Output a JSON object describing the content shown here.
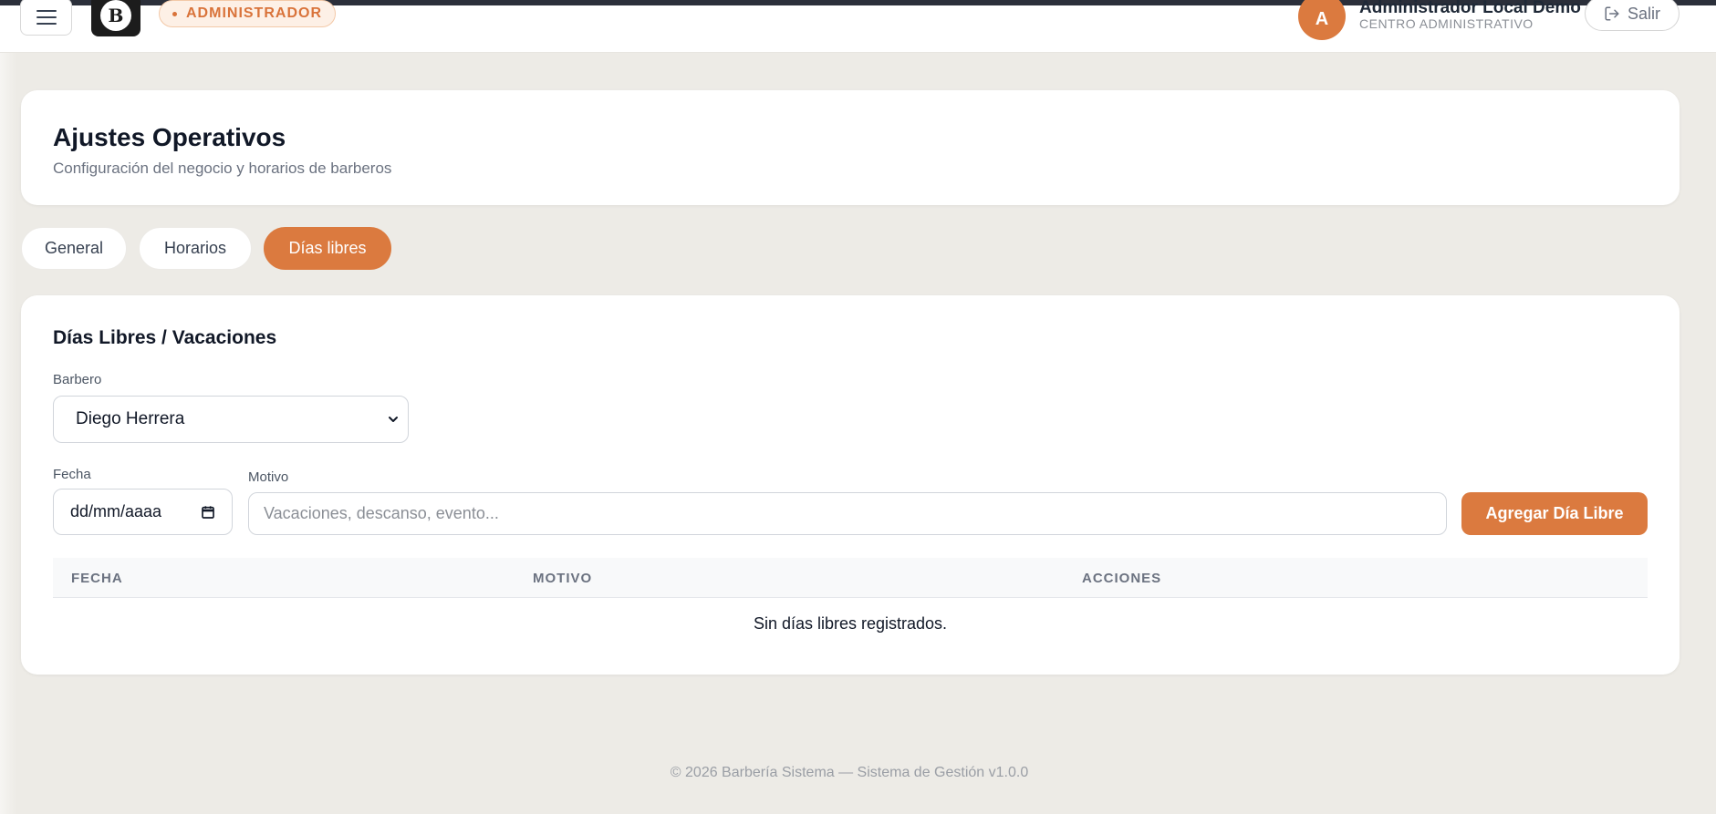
{
  "header": {
    "role_label": "ADMINISTRADOR",
    "user_initial": "A",
    "user_name": "Administrador Local Demo",
    "user_subtitle": "CENTRO ADMINISTRATIVO",
    "logout_label": "Salir"
  },
  "page": {
    "title": "Ajustes Operativos",
    "subtitle": "Configuración del negocio y horarios de barberos"
  },
  "tabs": [
    {
      "label": "General",
      "active": false
    },
    {
      "label": "Horarios",
      "active": false
    },
    {
      "label": "Días libres",
      "active": true
    }
  ],
  "section": {
    "title": "Días Libres / Vacaciones",
    "barber_label": "Barbero",
    "barber_selected": "Diego Herrera",
    "date_label": "Fecha",
    "date_placeholder": "dd/mm/aaaa",
    "reason_label": "Motivo",
    "reason_placeholder": "Vacaciones, descanso, evento...",
    "add_button_label": "Agregar Día Libre"
  },
  "table": {
    "columns": [
      "FECHA",
      "MOTIVO",
      "ACCIONES"
    ],
    "empty_message": "Sin días libres registrados."
  },
  "footer": {
    "text": "© 2026 Barbería Sistema — Sistema de Gestión v1.0.0"
  },
  "colors": {
    "accent": "#db7a3f",
    "background": "#edebe6"
  },
  "icons": {
    "menu": "hamburger-menu-icon",
    "logout": "logout-icon",
    "select": "chevron-down-icon",
    "calendar": "calendar-icon"
  }
}
